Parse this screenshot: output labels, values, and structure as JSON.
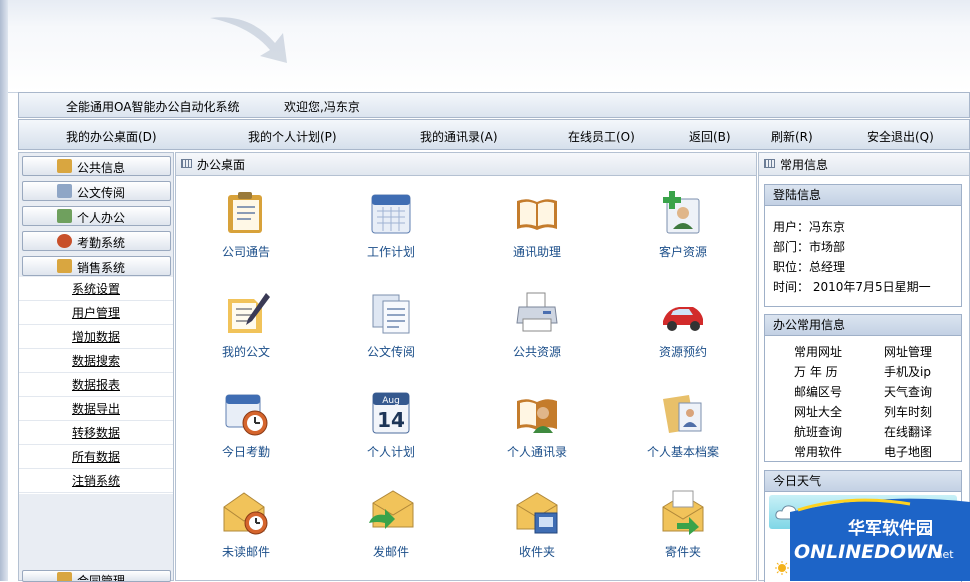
{
  "titlebar": {
    "system": "全能通用OA智能办公自动化系统",
    "welcome": "欢迎您,冯东京"
  },
  "nav": [
    "我的办公桌面(D)",
    "我的个人计划(P)",
    "我的通讯录(A)",
    "在线员工(O)",
    "返回(B)",
    "刷新(R)",
    "安全退出(Q)"
  ],
  "sidebar": {
    "categories": [
      "公共信息",
      "公文传阅",
      "个人办公",
      "考勤系统",
      "销售系统"
    ],
    "submenu": [
      "系统设置",
      "用户管理",
      "增加数据",
      "数据搜索",
      "数据报表",
      "数据导出",
      "转移数据",
      "所有数据",
      "注销系统"
    ],
    "bottom": "合同管理"
  },
  "center": {
    "title": "办公桌面",
    "apps": [
      {
        "label": "公司通告",
        "icon": "notice-board-icon"
      },
      {
        "label": "工作计划",
        "icon": "calendar-icon"
      },
      {
        "label": "通讯助理",
        "icon": "address-book-icon"
      },
      {
        "label": "客户资源",
        "icon": "customer-card-icon"
      },
      {
        "label": "我的公文",
        "icon": "document-pen-icon"
      },
      {
        "label": "公文传阅",
        "icon": "documents-icon"
      },
      {
        "label": "公共资源",
        "icon": "printer-icon"
      },
      {
        "label": "资源预约",
        "icon": "car-icon"
      },
      {
        "label": "今日考勤",
        "icon": "calendar-clock-icon"
      },
      {
        "label": "个人计划",
        "icon": "calendar-date-icon"
      },
      {
        "label": "个人通讯录",
        "icon": "contact-book-icon"
      },
      {
        "label": "个人基本档案",
        "icon": "personal-file-icon"
      },
      {
        "label": "未读邮件",
        "icon": "mail-clock-icon"
      },
      {
        "label": "发邮件",
        "icon": "mail-send-icon"
      },
      {
        "label": "收件夹",
        "icon": "inbox-icon"
      },
      {
        "label": "寄件夹",
        "icon": "outbox-icon"
      }
    ],
    "calendar_day": "14",
    "calendar_month": "Aug"
  },
  "right": {
    "title": "常用信息",
    "login": {
      "title": "登陆信息",
      "user": "用户：冯东京",
      "dept": "部门：市场部",
      "position": "职位：总经理",
      "time": "时间： 2010年7月5日星期一"
    },
    "links": {
      "title": "办公常用信息",
      "left": [
        "常用网址",
        "万 年 历",
        "邮编区号",
        "网址大全",
        "航班查询",
        "常用软件"
      ],
      "right": [
        "网址管理",
        "手机及ip",
        "天气查询",
        "列车时刻",
        "在线翻译",
        "电子地图"
      ]
    },
    "weather": {
      "title": "今日天气"
    }
  },
  "watermark": {
    "cn": "华军软件园",
    "en": "ONLINEDOWN",
    "suffix": ".net"
  },
  "colors": {
    "link": "#1c4f8a",
    "panel_border": "#b4c1d2",
    "header_grad": "#dbe4f0"
  }
}
